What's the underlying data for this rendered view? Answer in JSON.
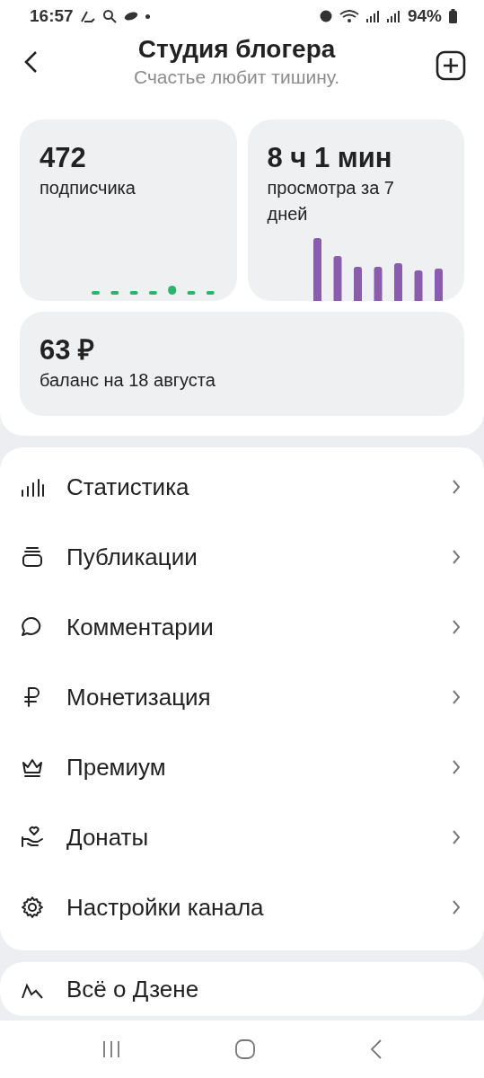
{
  "status_bar": {
    "time": "16:57",
    "battery": "94%"
  },
  "header": {
    "title": "Студия блогера",
    "subtitle": "Счастье любит тишину."
  },
  "stats": [
    {
      "kind": "dots",
      "value": "472",
      "label": "подписчика"
    },
    {
      "kind": "bars",
      "value": "8 ч 1 мин",
      "label": "просмотра за 7 дней"
    }
  ],
  "balance": {
    "value": "63 ₽",
    "label": "баланс на 18 августа"
  },
  "menu": [
    {
      "label": "Статистика"
    },
    {
      "label": "Публикации"
    },
    {
      "label": "Комментарии"
    },
    {
      "label": "Монетизация"
    },
    {
      "label": "Премиум"
    },
    {
      "label": "Донаты"
    },
    {
      "label": "Настройки канала"
    }
  ],
  "more_menu": [
    {
      "label": "Всё о Дзене"
    }
  ]
}
